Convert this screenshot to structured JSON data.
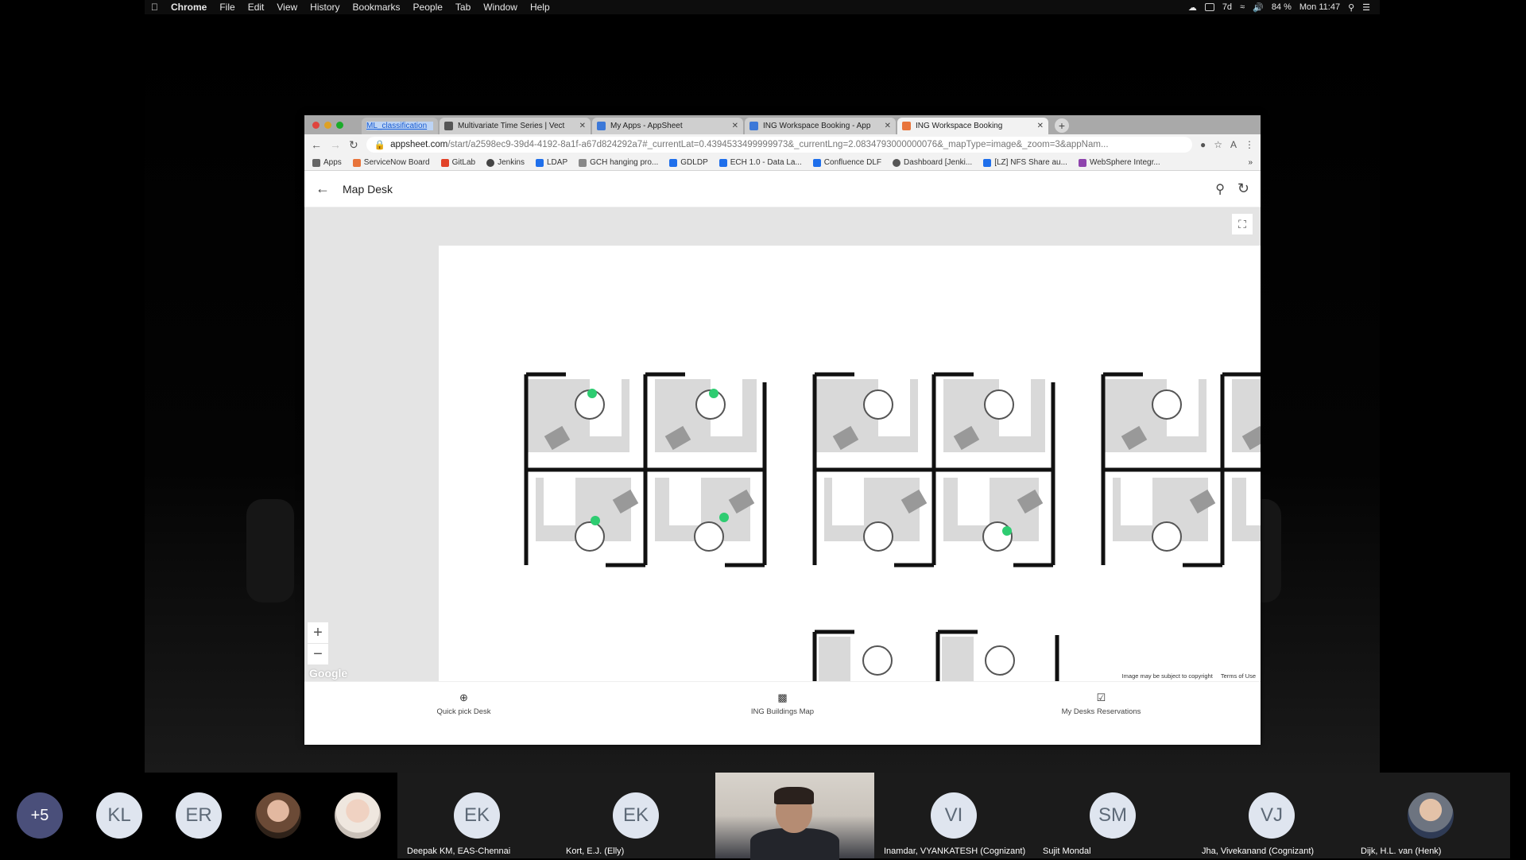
{
  "menubar": {
    "app": "Chrome",
    "items": [
      "File",
      "Edit",
      "View",
      "History",
      "Bookmarks",
      "People",
      "Tab",
      "Window",
      "Help"
    ],
    "battery": "84 %",
    "clock": "Mon 11:47",
    "status_extra": "7d"
  },
  "browser": {
    "tabs": [
      {
        "title": "ML_classification",
        "active": false
      },
      {
        "title": "Multivariate Time Series | Vect",
        "active": false
      },
      {
        "title": "My Apps - AppSheet",
        "active": false
      },
      {
        "title": "ING Workspace Booking - App",
        "active": false
      },
      {
        "title": "ING Workspace Booking",
        "active": true
      }
    ],
    "new_tab": "+",
    "url_host": "appsheet.com",
    "url_path": "/start/a2598ec9-39d4-4192-8a1f-a67d824292a7#_currentLat=0.4394533499999973&_currentLng=2.0834793000000076&_mapType=image&_zoom=3&appNam...",
    "bookmarks": [
      {
        "label": "Apps",
        "color": "#666"
      },
      {
        "label": "ServiceNow Board",
        "color": "#e8743b"
      },
      {
        "label": "GitLab",
        "color": "#e24329"
      },
      {
        "label": "Jenkins",
        "color": "#444"
      },
      {
        "label": "LDAP",
        "color": "#1f6feb"
      },
      {
        "label": "GCH hanging pro...",
        "color": "#888"
      },
      {
        "label": "GDLDP",
        "color": "#1f6feb"
      },
      {
        "label": "ECH 1.0 - Data La...",
        "color": "#1f6feb"
      },
      {
        "label": "Confluence DLF",
        "color": "#1f6feb"
      },
      {
        "label": "Dashboard [Jenki...",
        "color": "#555"
      },
      {
        "label": "[LZ] NFS Share au...",
        "color": "#1f6feb"
      },
      {
        "label": "WebSphere Integr...",
        "color": "#8e44ad"
      }
    ],
    "bookmarks_more": "»"
  },
  "app": {
    "title": "Map Desk",
    "google": "Google",
    "copyright": "Image may be subject to copyright",
    "terms": "Terms of Use",
    "nav": [
      {
        "label": "Quick pick Desk",
        "icon": "target-icon"
      },
      {
        "label": "ING Buildings Map",
        "icon": "building-icon"
      },
      {
        "label": "My Desks Reservations",
        "icon": "calendar-icon"
      }
    ]
  },
  "participants": [
    {
      "initials": "+5",
      "name": ""
    },
    {
      "initials": "KL",
      "name": ""
    },
    {
      "initials": "ER",
      "name": ""
    },
    {
      "initials": "",
      "name": ""
    },
    {
      "initials": "",
      "name": ""
    },
    {
      "initials": "EK",
      "name": "Deepak KM, EAS-Chennai"
    },
    {
      "initials": "EK",
      "name": "Kort, E.J. (Elly)"
    },
    {
      "initials": "",
      "name": ""
    },
    {
      "initials": "VI",
      "name": "Inamdar, VYANKATESH (Cognizant)"
    },
    {
      "initials": "SM",
      "name": "Sujit Mondal"
    },
    {
      "initials": "VJ",
      "name": "Jha, Vivekanand (Cognizant)"
    },
    {
      "initials": "",
      "name": "Dijk, H.L. van (Henk)"
    }
  ]
}
